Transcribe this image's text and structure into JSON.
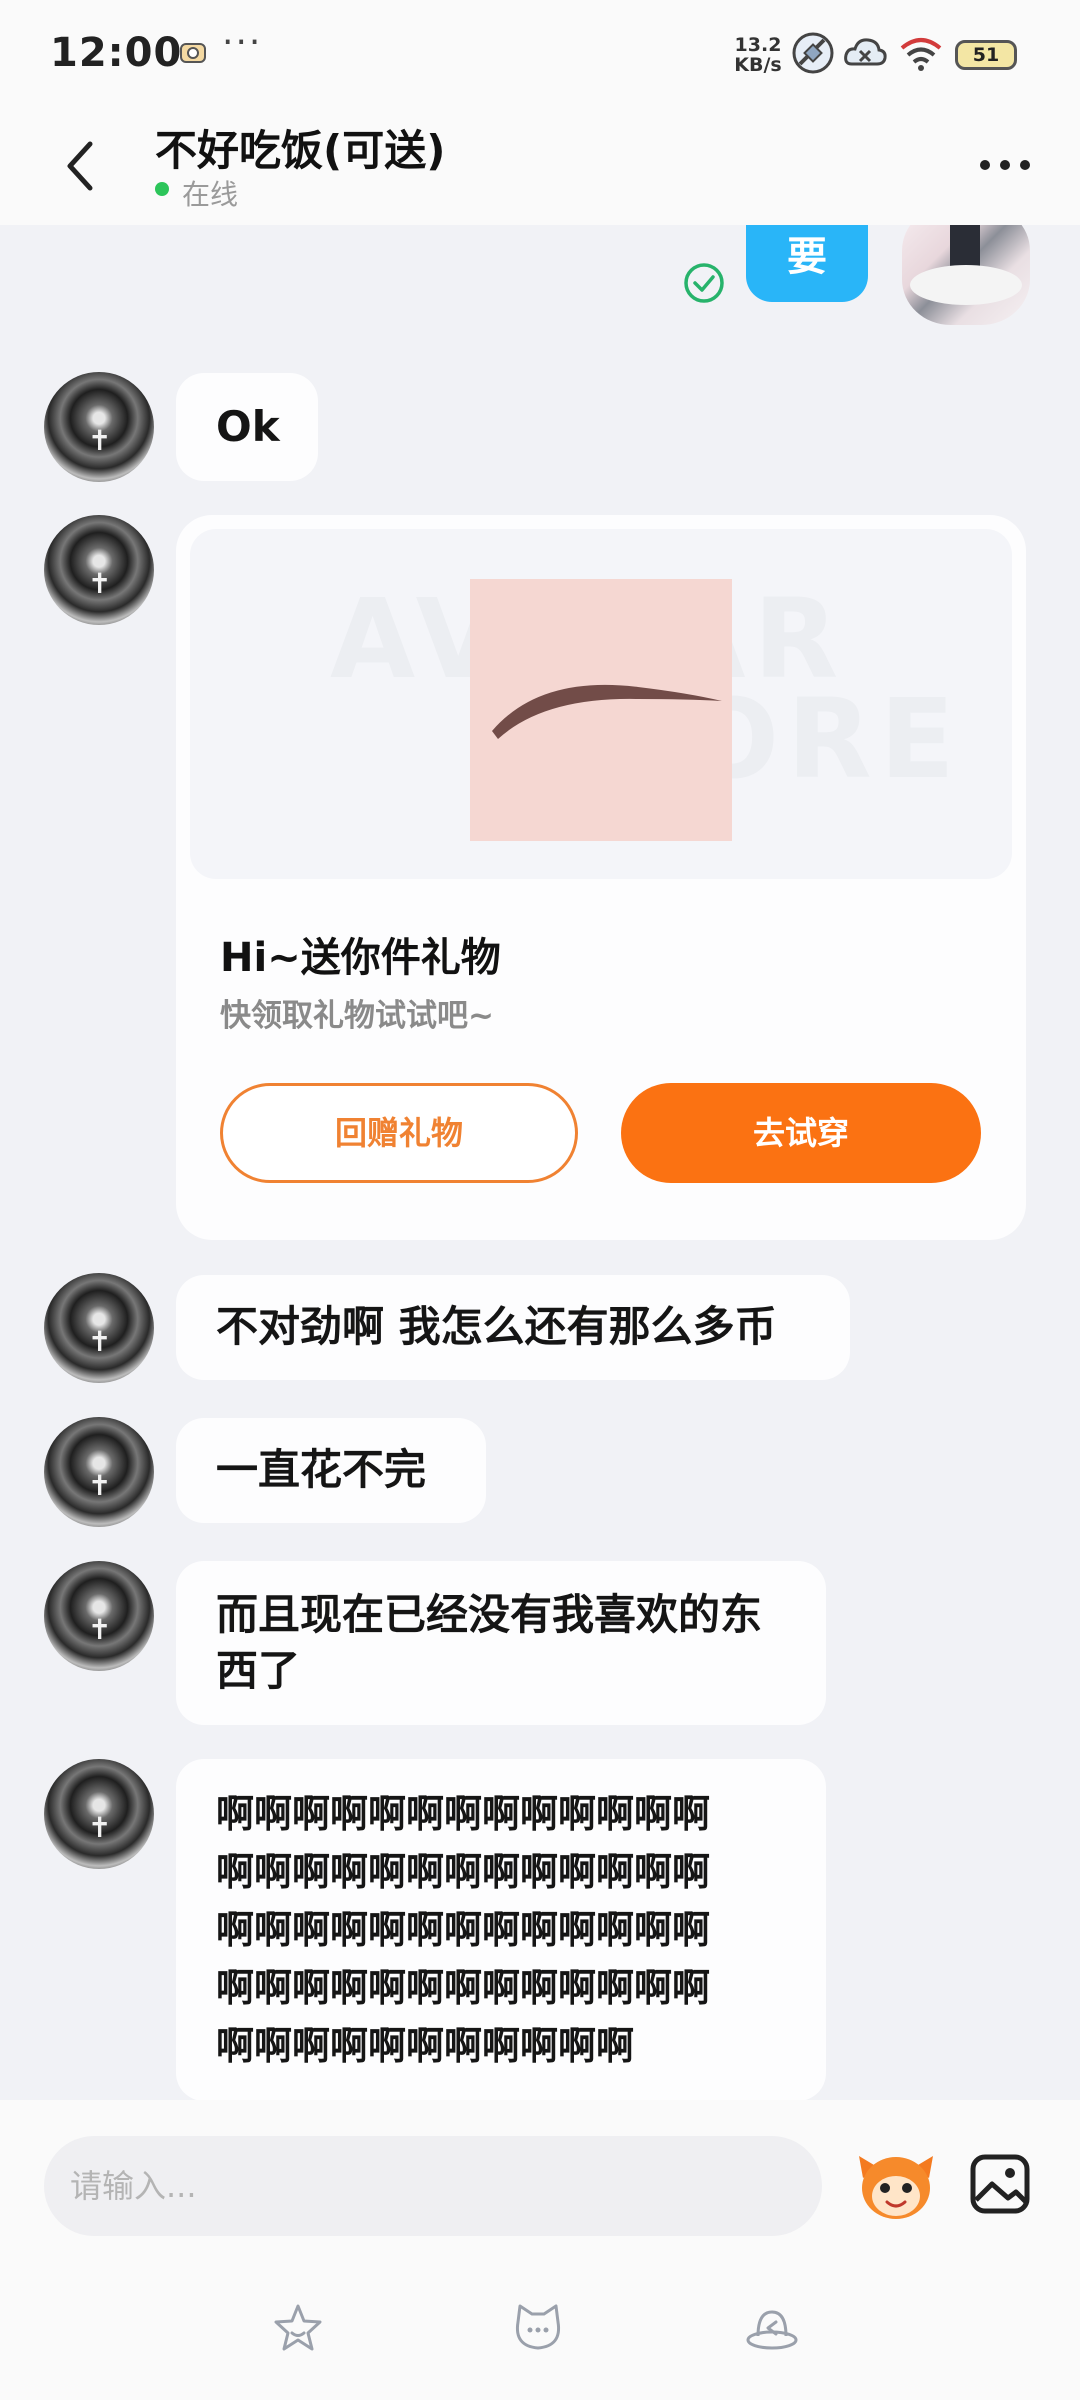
{
  "status_bar": {
    "time": "12:00",
    "more": "···",
    "net_speed_value": "13.2",
    "net_speed_unit": "KB/s",
    "battery": "51",
    "icons": [
      "photo-notification-icon",
      "satellite-icon",
      "cloud-error-icon",
      "wifi-icon",
      "battery-icon"
    ]
  },
  "header": {
    "title": "不好吃饭(可送)",
    "status": "在线",
    "status_color": "#2cc55a",
    "icons": [
      "back-arrow-icon",
      "more-options-icon"
    ]
  },
  "chat": {
    "sent_message": "要",
    "messages": [
      {
        "text": "Ok"
      },
      {
        "text": "不对劲啊 我怎么还有那么多币"
      },
      {
        "text": "一直花不完"
      },
      {
        "lines": [
          "而且现在已经没有我喜欢的东",
          "西了"
        ]
      },
      {
        "lines": [
          "啊啊啊啊啊啊啊啊啊啊啊啊啊",
          "啊啊啊啊啊啊啊啊啊啊啊啊啊",
          "啊啊啊啊啊啊啊啊啊啊啊啊啊",
          "啊啊啊啊啊啊啊啊啊啊啊啊啊",
          "啊啊啊啊啊啊啊啊啊啊啊"
        ]
      }
    ],
    "gift_card": {
      "title": "Hi~送你件礼物",
      "subtitle": "快领取礼物试试吧~",
      "return_button": "回赠礼物",
      "try_button": "去试穿",
      "accent_color": "#fb7212"
    }
  },
  "input_bar": {
    "placeholder": "请输入...",
    "icons": [
      "sticker-mascot-icon",
      "image-icon"
    ]
  },
  "bottom_nav": {
    "icons": [
      "star-icon",
      "cat-face-icon",
      "hat-icon"
    ]
  },
  "colors": {
    "sent_bubble": "#29b5f8",
    "background": "#f1f2f6",
    "bubble": "#fdfdfe"
  }
}
